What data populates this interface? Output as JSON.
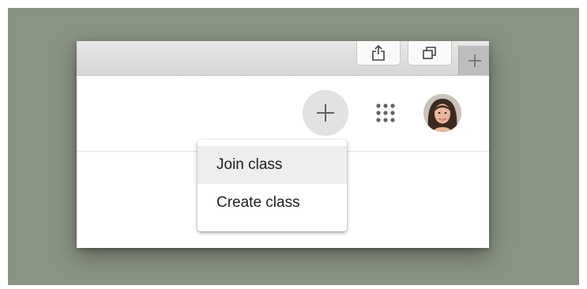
{
  "colors": {
    "backdrop": "#8a9483",
    "toolbar": "#dcdcdc",
    "add_button_bg": "#e2e2e2",
    "menu_hover": "#eeeeee",
    "text": "#202124"
  },
  "toolbar": {
    "share_icon": "share-icon",
    "tabs_icon": "tabs-overview-icon",
    "new_tab_icon": "plus-icon"
  },
  "header": {
    "add_icon": "plus-icon",
    "apps_icon": "apps-grid-icon",
    "avatar_icon": "user-avatar"
  },
  "menu": {
    "items": [
      {
        "label": "Join class",
        "highlighted": true
      },
      {
        "label": "Create class",
        "highlighted": false
      }
    ]
  }
}
